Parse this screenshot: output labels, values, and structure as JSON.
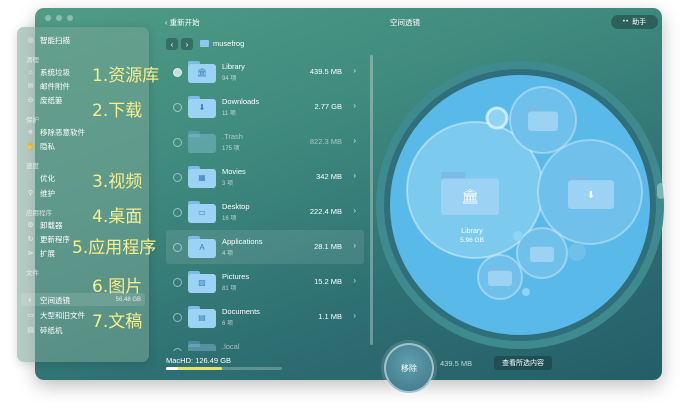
{
  "window": {
    "back_label": "重新开始",
    "title": "空间透镜",
    "assistant_label": "助手",
    "assistant_dots": "••"
  },
  "sidebar": {
    "items": [
      {
        "label": "智能扫描",
        "icon": "scan-icon"
      },
      {
        "label": "系统垃圾",
        "icon": "trash-icon"
      },
      {
        "label": "邮件附件",
        "icon": "mail-icon"
      },
      {
        "label": "废纸篓",
        "icon": "bin-icon"
      },
      {
        "label": "移除恶意软件",
        "icon": "biohazard-icon"
      },
      {
        "label": "隐私",
        "icon": "hand-icon"
      },
      {
        "label": "优化",
        "icon": "sliders-icon"
      },
      {
        "label": "维护",
        "icon": "wrench-icon"
      },
      {
        "label": "卸载器",
        "icon": "uninstaller-icon"
      },
      {
        "label": "更新程序",
        "icon": "update-icon"
      },
      {
        "label": "扩展",
        "icon": "extension-icon"
      },
      {
        "label": "空间透镜",
        "icon": "lens-icon",
        "size": "56.48 GB"
      },
      {
        "label": "大型和旧文件",
        "icon": "folder-icon"
      },
      {
        "label": "碎纸机",
        "icon": "shredder-icon"
      }
    ],
    "sections": [
      "清理",
      "保护",
      "速度",
      "应用程序",
      "文件"
    ]
  },
  "overlays": [
    "1.资源库",
    "2.下载",
    "3.视频",
    "4.桌面",
    "5.应用程序",
    "6.图片",
    "7.文稿"
  ],
  "breadcrumb": {
    "folder": "musefrog"
  },
  "rows": [
    {
      "name": "Library",
      "count": "94 项",
      "size": "439.5 MB",
      "glyph": "🏛",
      "dim": false,
      "state": "part"
    },
    {
      "name": "Downloads",
      "count": "11 项",
      "size": "2.77 GB",
      "glyph": "⬇",
      "dim": false,
      "state": "none"
    },
    {
      "name": ".Trash",
      "count": "175 项",
      "size": "822.3 MB",
      "glyph": "",
      "dim": true,
      "state": "none"
    },
    {
      "name": "Movies",
      "count": "3 项",
      "size": "342 MB",
      "glyph": "▦",
      "dim": false,
      "state": "none"
    },
    {
      "name": "Desktop",
      "count": "16 项",
      "size": "222.4 MB",
      "glyph": "▭",
      "dim": false,
      "state": "none"
    },
    {
      "name": "Applications",
      "count": "4 项",
      "size": "28.1 MB",
      "glyph": "A",
      "dim": false,
      "state": "none"
    },
    {
      "name": "Pictures",
      "count": "81 项",
      "size": "15.2 MB",
      "glyph": "▨",
      "dim": false,
      "state": "none"
    },
    {
      "name": "Documents",
      "count": "6 项",
      "size": "1.1 MB",
      "glyph": "▤",
      "dim": false,
      "state": "none"
    },
    {
      "name": ".local",
      "count": "",
      "size": "",
      "glyph": "",
      "dim": true,
      "state": "none"
    }
  ],
  "disk": {
    "label": "MacHD: 126.49 GB",
    "used_fraction": 0.48,
    "selected_fraction": 0.1
  },
  "bubble": {
    "label": "Library",
    "size": "5.96 GB"
  },
  "bottom": {
    "remove_label": "移除",
    "selected_size": "439.5 MB",
    "view_selected_label": "查看所选内容"
  },
  "colors": {
    "accent_yellow": "#f7f08a",
    "folder_blue": "#9cd2f4",
    "bubble_blue": "#59b9e8"
  }
}
